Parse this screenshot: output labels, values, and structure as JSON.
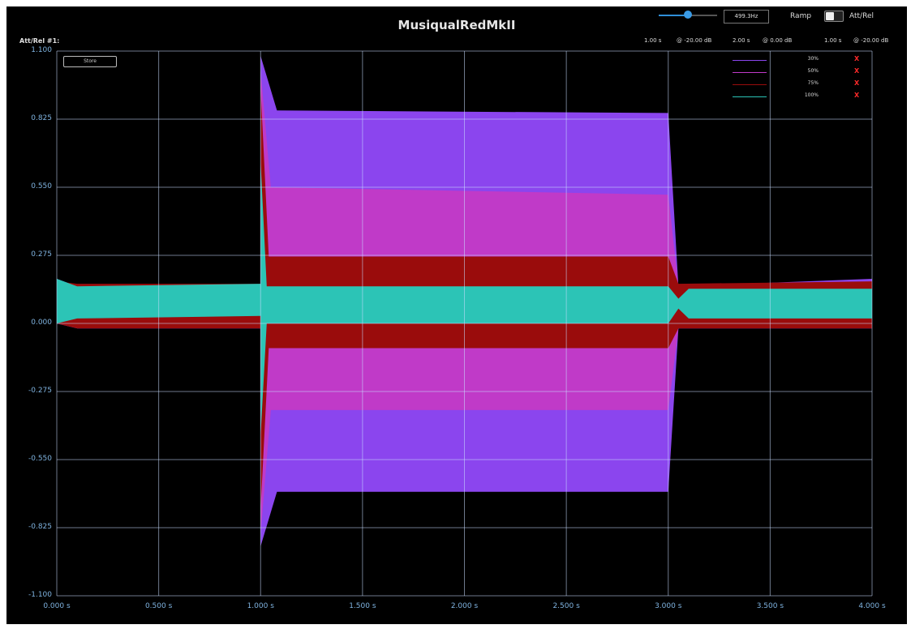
{
  "header": {
    "title": "MusiqualRedMkII",
    "att_rel_label": "Att/Rel #1:",
    "frequency": "499.3Hz",
    "ramp_label": "Ramp",
    "att_rel_toggle_label": "Att/Rel",
    "envelope": [
      {
        "time": "1.00 s",
        "level": "@ -20.00 dB"
      },
      {
        "time": "2.00 s",
        "level": "@ 0.00 dB"
      },
      {
        "time": "1.00 s",
        "level": "@ -20.00 dB"
      }
    ]
  },
  "store_button": "Store",
  "legend": [
    {
      "label": "30%",
      "color": "#8b45ee",
      "remove": "X"
    },
    {
      "label": "50%",
      "color": "#c03ac8",
      "remove": "X"
    },
    {
      "label": "75%",
      "color": "#9a0c0c",
      "remove": "X"
    },
    {
      "label": "100%",
      "color": "#2cc4b6",
      "remove": "X"
    }
  ],
  "chart_data": {
    "type": "area",
    "xlabel": "",
    "ylabel": "",
    "xlim": [
      0,
      4
    ],
    "ylim": [
      -1.1,
      1.1
    ],
    "grid": true,
    "legend_position": "top-right",
    "x_ticks": [
      "0.000 s",
      "0.500 s",
      "1.000 s",
      "1.500 s",
      "2.000 s",
      "2.500 s",
      "3.000 s",
      "3.500 s",
      "4.000 s"
    ],
    "y_ticks": [
      "1.100",
      "0.825",
      "0.550",
      "0.275",
      "0.000",
      "-0.275",
      "-0.550",
      "-0.825",
      "-1.100"
    ],
    "x_tick_values": [
      0,
      0.5,
      1,
      1.5,
      2,
      2.5,
      3,
      3.5,
      4
    ],
    "y_tick_values": [
      1.1,
      0.825,
      0.55,
      0.275,
      0,
      -0.275,
      -0.55,
      -0.825,
      -1.1
    ],
    "series": [
      {
        "name": "30%",
        "color": "#8b45ee",
        "upper": [
          [
            0,
            0.18
          ],
          [
            0.1,
            0.15
          ],
          [
            1.0,
            0.15
          ],
          [
            1.0,
            1.08
          ],
          [
            1.08,
            0.86
          ],
          [
            3.0,
            0.85
          ],
          [
            3.05,
            0.15
          ],
          [
            4.0,
            0.18
          ]
        ],
        "lower": [
          [
            0,
            0.0
          ],
          [
            0.1,
            -0.02
          ],
          [
            1.0,
            -0.02
          ],
          [
            1.0,
            -0.9
          ],
          [
            1.08,
            -0.68
          ],
          [
            3.0,
            -0.68
          ],
          [
            3.05,
            -0.02
          ],
          [
            4.0,
            -0.02
          ]
        ]
      },
      {
        "name": "50%",
        "color": "#c03ac8",
        "upper": [
          [
            0,
            0.17
          ],
          [
            0.1,
            0.15
          ],
          [
            1.0,
            0.15
          ],
          [
            1.0,
            1.02
          ],
          [
            1.05,
            0.55
          ],
          [
            3.0,
            0.52
          ],
          [
            3.05,
            0.15
          ],
          [
            4.0,
            0.17
          ]
        ],
        "lower": [
          [
            0,
            0.0
          ],
          [
            0.1,
            -0.02
          ],
          [
            1.0,
            -0.02
          ],
          [
            1.0,
            -0.85
          ],
          [
            1.05,
            -0.35
          ],
          [
            3.0,
            -0.35
          ],
          [
            3.05,
            -0.02
          ],
          [
            4.0,
            -0.02
          ]
        ]
      },
      {
        "name": "75%",
        "color": "#9a0c0c",
        "upper": [
          [
            0,
            0.17
          ],
          [
            0.1,
            0.16
          ],
          [
            1.0,
            0.16
          ],
          [
            1.0,
            0.95
          ],
          [
            1.04,
            0.27
          ],
          [
            3.0,
            0.27
          ],
          [
            3.05,
            0.16
          ],
          [
            4.0,
            0.17
          ]
        ],
        "lower": [
          [
            0,
            0.0
          ],
          [
            0.1,
            -0.02
          ],
          [
            1.0,
            -0.02
          ],
          [
            1.0,
            -0.75
          ],
          [
            1.04,
            -0.1
          ],
          [
            3.0,
            -0.1
          ],
          [
            3.05,
            -0.02
          ],
          [
            4.0,
            -0.02
          ]
        ]
      },
      {
        "name": "100%",
        "color": "#2cc4b6",
        "upper": [
          [
            0,
            0.18
          ],
          [
            0.1,
            0.15
          ],
          [
            1.0,
            0.16
          ],
          [
            1.0,
            0.65
          ],
          [
            1.03,
            0.15
          ],
          [
            3.0,
            0.15
          ],
          [
            3.05,
            0.1
          ],
          [
            3.1,
            0.14
          ],
          [
            4.0,
            0.14
          ]
        ],
        "lower": [
          [
            0,
            0.0
          ],
          [
            0.1,
            0.02
          ],
          [
            1.0,
            0.03
          ],
          [
            1.0,
            -0.45
          ],
          [
            1.03,
            0.0
          ],
          [
            3.0,
            0.0
          ],
          [
            3.05,
            0.06
          ],
          [
            3.1,
            0.02
          ],
          [
            4.0,
            0.02
          ]
        ]
      }
    ]
  }
}
